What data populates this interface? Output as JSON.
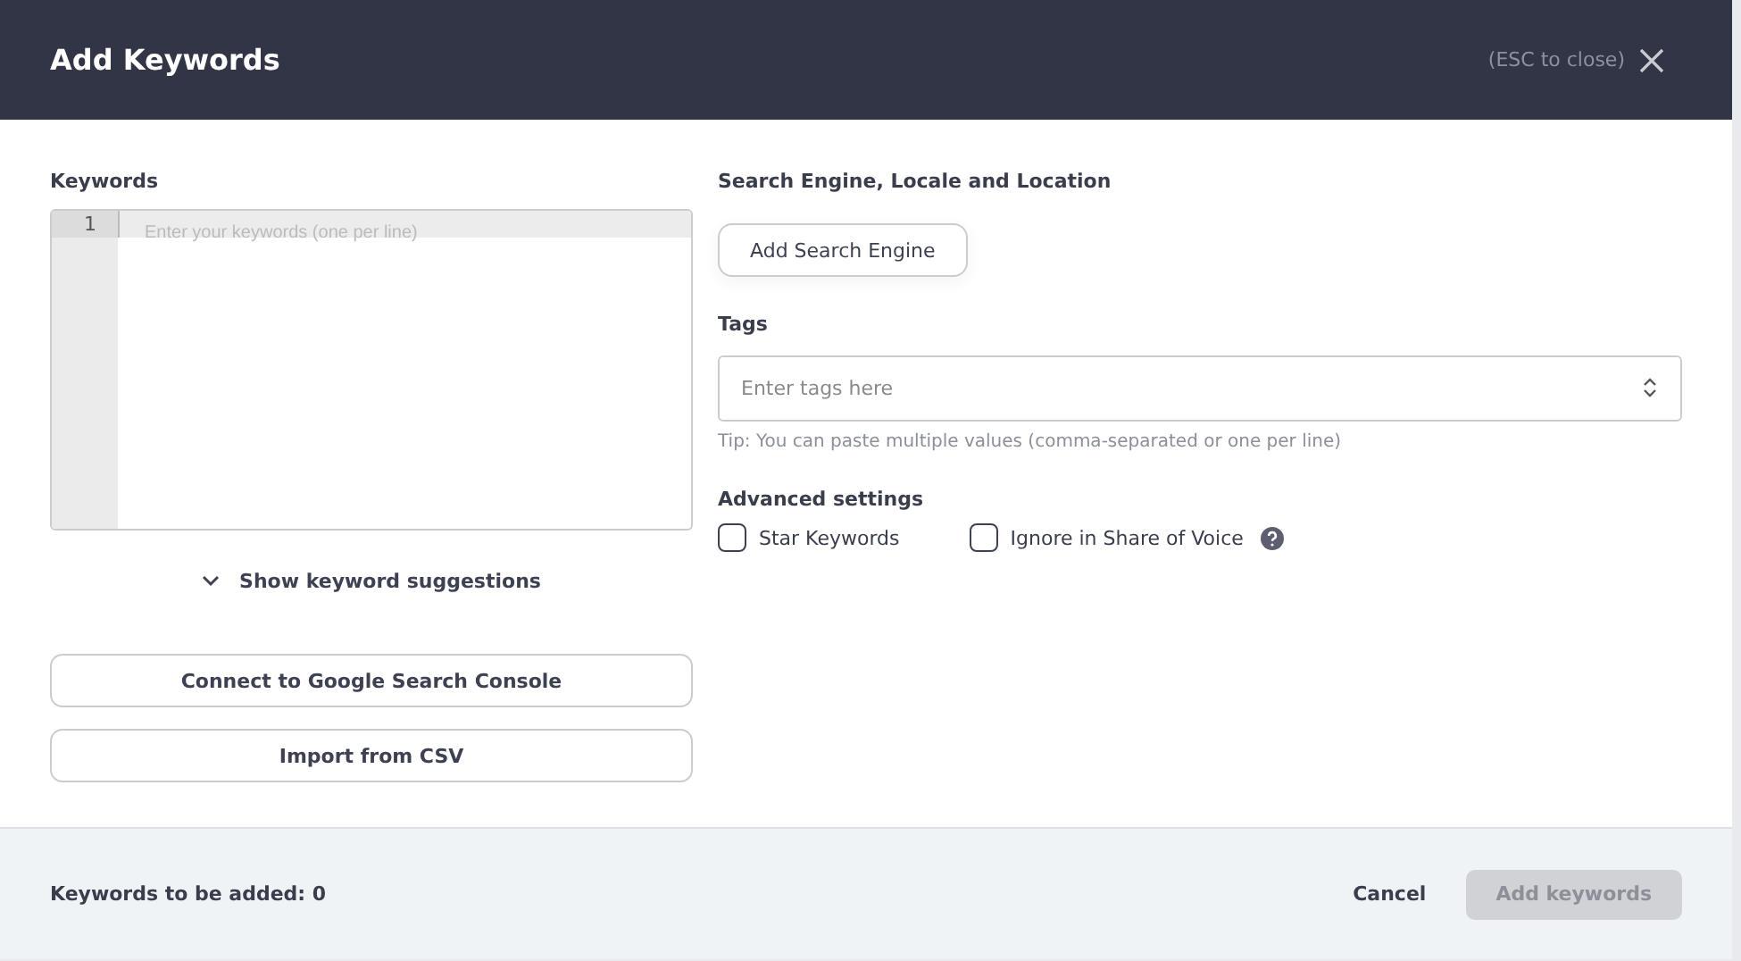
{
  "window": {
    "title": "Add Keywords",
    "close_hint": "(ESC to close)"
  },
  "keywords": {
    "label": "Keywords",
    "line_number": "1",
    "placeholder": "Enter your keywords (one per line)"
  },
  "suggestions": {
    "label": "Show keyword suggestions",
    "expanded": false
  },
  "import_buttons": [
    "Connect to Google Search Console",
    "Import from CSV"
  ],
  "search_engine": {
    "label": "Search Engine, Locale and Location",
    "button": "Add Search Engine"
  },
  "tags": {
    "label": "Tags",
    "placeholder": "Enter tags here",
    "tip": "Tip: You can paste multiple values (comma-separated or one per line)"
  },
  "advanced": {
    "label": "Advanced settings",
    "options": [
      {
        "label": "Star Keywords",
        "checked": false,
        "help": false
      },
      {
        "label": "Ignore in Share of Voice",
        "checked": false,
        "help": true
      }
    ]
  },
  "footer": {
    "count": "Keywords to be added: **0**",
    "cancel": "Cancel",
    "submit": {
      "label": "Add keywords",
      "disabled": true
    }
  }
}
